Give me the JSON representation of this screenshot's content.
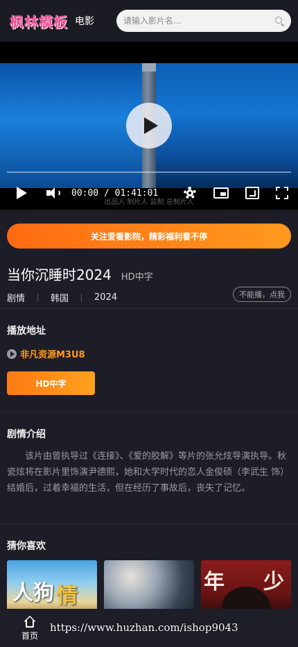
{
  "header": {
    "logo": "枫林模板",
    "nav_movie": "电影",
    "search_placeholder": "请输入影片名..."
  },
  "player": {
    "time_display": "00:00 / 01:41:01",
    "progress": 0,
    "subtitle": "出品人 制片人 监制 总制片人"
  },
  "banner": {
    "text": "关注爱看影院，精彩福利看不停"
  },
  "movie": {
    "title": "当你沉睡时2024",
    "quality": "HD中字",
    "genre": "剧情",
    "region": "韩国",
    "year": "2024",
    "report_label": "不能播，点我"
  },
  "play_section": {
    "title": "播放地址",
    "source_name": "非凡资源M3U8",
    "episodes": [
      "HD中字"
    ]
  },
  "synopsis": {
    "title": "剧情介绍",
    "text": "该片由曾执导过《连接》、《爱的胶解》等片的张允炫导演执导。秋瓷炫将在影片里饰演尹德熙，她和大学时代的恋人金俊硕（李武生 饰）结婚后，过着幸福的生活，但在经历了事故后，丧失了记忆。"
  },
  "recommend": {
    "title": "猜你喜欢",
    "posters": [
      {
        "text_a": "人狗",
        "text_b": "情"
      },
      {
        "text_a": ""
      },
      {
        "text_a": "年",
        "text_b": "少"
      }
    ]
  },
  "bottombar": {
    "home_label": "首页"
  },
  "watermark": "https://www.huzhan.com/ishop9043",
  "colors": {
    "accent": "#ff9a1e",
    "logo": "#f04d96",
    "background": "#1d1d27"
  }
}
